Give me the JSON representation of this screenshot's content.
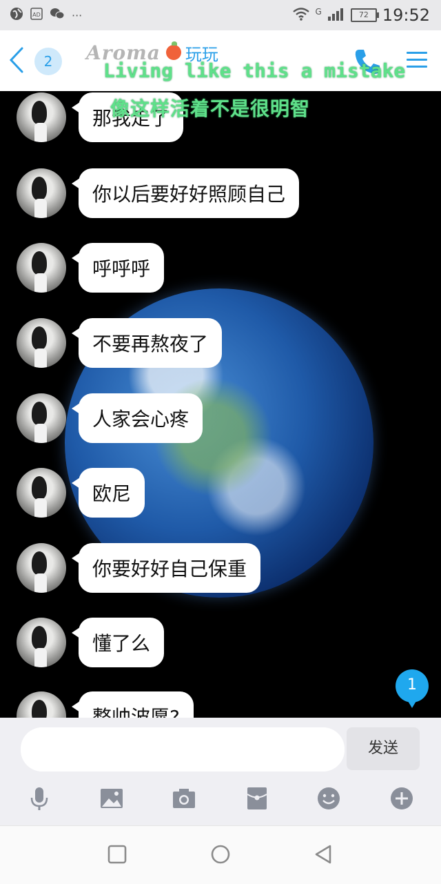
{
  "status_bar": {
    "time": "19:52",
    "battery": "72",
    "network": "G",
    "icons": [
      "globe-icon",
      "ad-icon",
      "wechat-icon",
      "more-dots-icon",
      "wifi-icon",
      "signal-icon"
    ]
  },
  "header": {
    "back_icon": "chevron-left-icon",
    "unread_count": "2",
    "logo_text": "Aroma",
    "chat_name": "玩玩",
    "subtitle_en": "Living like this a mistake",
    "subtitle_zh": "像这样活着不是很明智",
    "call_icon": "phone-icon",
    "menu_icon": "hamburger-menu-icon"
  },
  "messages": [
    {
      "text": "那我走了"
    },
    {
      "text": "你以后要好好照顾自己"
    },
    {
      "text": "呼呼呼"
    },
    {
      "text": "不要再熬夜了"
    },
    {
      "text": "人家会心疼"
    },
    {
      "text": "欧尼"
    },
    {
      "text": "你要好好自己保重"
    },
    {
      "text": "懂了么"
    },
    {
      "text": "整帅波愿?"
    }
  ],
  "new_message_badge": "1",
  "composer": {
    "input_value": "",
    "send_label": "发送",
    "tools": [
      "microphone-icon",
      "image-icon",
      "camera-icon",
      "red-packet-icon",
      "emoji-icon",
      "plus-icon"
    ]
  },
  "navbar": [
    "square-recent-icon",
    "circle-home-icon",
    "triangle-back-icon"
  ],
  "colors": {
    "accent": "#2a9fe8",
    "subtitle": "#5fe08a",
    "chat_bg": "#000000"
  }
}
